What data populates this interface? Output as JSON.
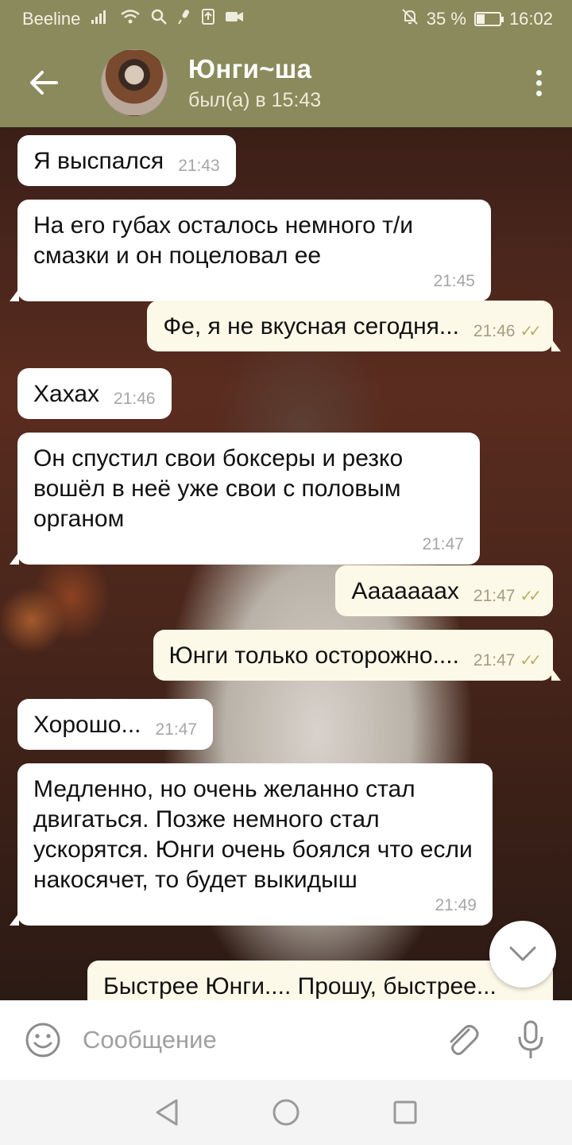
{
  "status_bar": {
    "carrier": "Beeline",
    "battery_text": "35 %",
    "battery_level": 0.35,
    "time": "16:02"
  },
  "header": {
    "title": "Юнги~ша",
    "status": "был(а) в 15:43"
  },
  "messages": [
    {
      "dir": "in",
      "text": "Я выспался",
      "time": "21:43"
    },
    {
      "dir": "in",
      "text": "На его губах осталось немного т/и смазки и он поцеловал ее",
      "time": "21:45"
    },
    {
      "dir": "out",
      "text": "Фе, я не вкусная сегодня...",
      "time": "21:46",
      "read": true
    },
    {
      "dir": "in",
      "text": "Хахах",
      "time": "21:46"
    },
    {
      "dir": "in",
      "text": "Он спустил свои боксеры и резко вошёл в неё уже свои с половым органом",
      "time": "21:47"
    },
    {
      "dir": "out",
      "text": "Аааааaах",
      "time": "21:47",
      "read": true
    },
    {
      "dir": "out",
      "text": "Юнги только осторожно....",
      "time": "21:47",
      "read": true
    },
    {
      "dir": "in",
      "text": "Хорошо...",
      "time": "21:47"
    },
    {
      "dir": "in",
      "text": "Медленно, но очень желанно стал двигаться. Позже немного стал ускорятся. Юнги очень боялся что если накосячет, то будет выкидыш",
      "time": "21:49"
    },
    {
      "dir": "out",
      "text": "Быстрее Юнги.... Прошу, быстрее...",
      "time": ""
    }
  ],
  "input": {
    "placeholder": "Сообщение"
  },
  "icons": {
    "back": "arrow-left-icon",
    "menu": "more-vertical-icon",
    "emoji": "smile-icon",
    "attach": "paperclip-icon",
    "mic": "microphone-icon",
    "scroll": "chevron-down-icon"
  },
  "colors": {
    "header": "#8a8a5c",
    "incoming_bubble": "#ffffff",
    "outgoing_bubble": "#fdf9e8",
    "read_check": "#b8ad6a"
  }
}
